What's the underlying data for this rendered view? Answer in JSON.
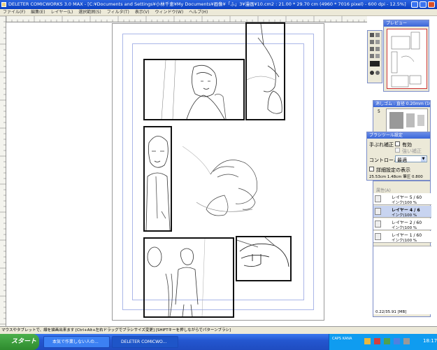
{
  "window": {
    "title": "DELETER COMICWORKS 3.0 MAX - [C:¥Documents and Settings¥小林千恵¥My Documents¥画像¥「ふ」3¥漫画¥10.cm2 : 21.00 * 29.70 cm (4960 * 7016 pixel) - 600 dpi - 12.5%]"
  },
  "menu": [
    "ファイル(F)",
    "編集(E)",
    "レイヤー(L)",
    "選択範囲(S)",
    "フィルタ(T)",
    "表示(V)",
    "ウィンドウ(W)",
    "ヘルプ(H)"
  ],
  "preview_panel": {
    "title": "プレビュー"
  },
  "brush_panel": {
    "title": "消しゴム : 直径 0.20mm (10...",
    "size_label": "5"
  },
  "brush_settings": {
    "title": "ブラシツール設定",
    "stabilizer_label": "手ぶれ補正",
    "enabled_label": "有効",
    "enabled_checked": false,
    "strong_label": "強い補正",
    "control_label": "コントロール",
    "control_value": "最適",
    "detail_label": "詳細設定の表示",
    "readout": "25.53cm 1.48cm 筆圧 0.800"
  },
  "layer_panel": {
    "header_label": "属性(A)",
    "layers": [
      {
        "name": "レイヤー 5 / 60",
        "sub": "インク(100 %",
        "active": false
      },
      {
        "name": "レイヤー 4 / 6",
        "sub": "インク(100 %",
        "active": true
      },
      {
        "name": "レイヤー 2 / 60",
        "sub": "インク(100 %",
        "active": false
      },
      {
        "name": "レイヤー 1 / 60",
        "sub": "インク(100 %",
        "active": false
      }
    ],
    "memory": "0.22/35.91 [MB]"
  },
  "status_bar": "マウスやタブレットで、線を描画出来ます [Ctrl+Alt+左右ドラッグでブラシサイズ変更] [SHIFTキーを押しながらでパターンブラシ]",
  "taskbar": {
    "start_label": "スタート",
    "tasks": [
      "本気で作業しない人の...",
      "DELETER COMICWO..."
    ],
    "clock": "18:17",
    "ime": "CAPS KANA"
  }
}
